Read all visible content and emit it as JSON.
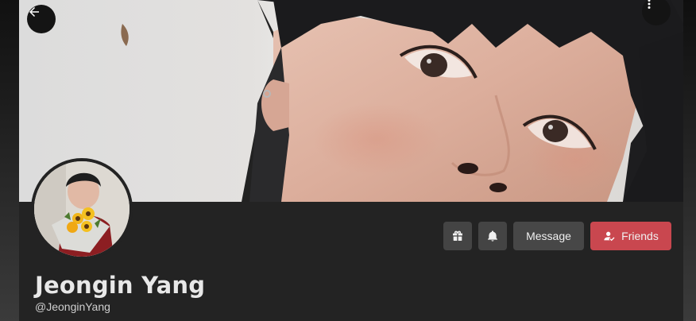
{
  "profile": {
    "display_name": "Jeongin Yang",
    "username": "@JeonginYang"
  },
  "actions": {
    "message_label": "Message",
    "friends_label": "Friends"
  },
  "icons": {
    "back": "arrow-left-icon",
    "more": "more-vertical-icon",
    "gift": "gift-icon",
    "bell": "bell-icon",
    "friends": "user-check-icon"
  },
  "colors": {
    "card_background": "#232323",
    "button_neutral": "#444444",
    "button_primary": "#c9474f",
    "text_primary": "#e8e8e8",
    "text_secondary": "#cfcfcf"
  }
}
